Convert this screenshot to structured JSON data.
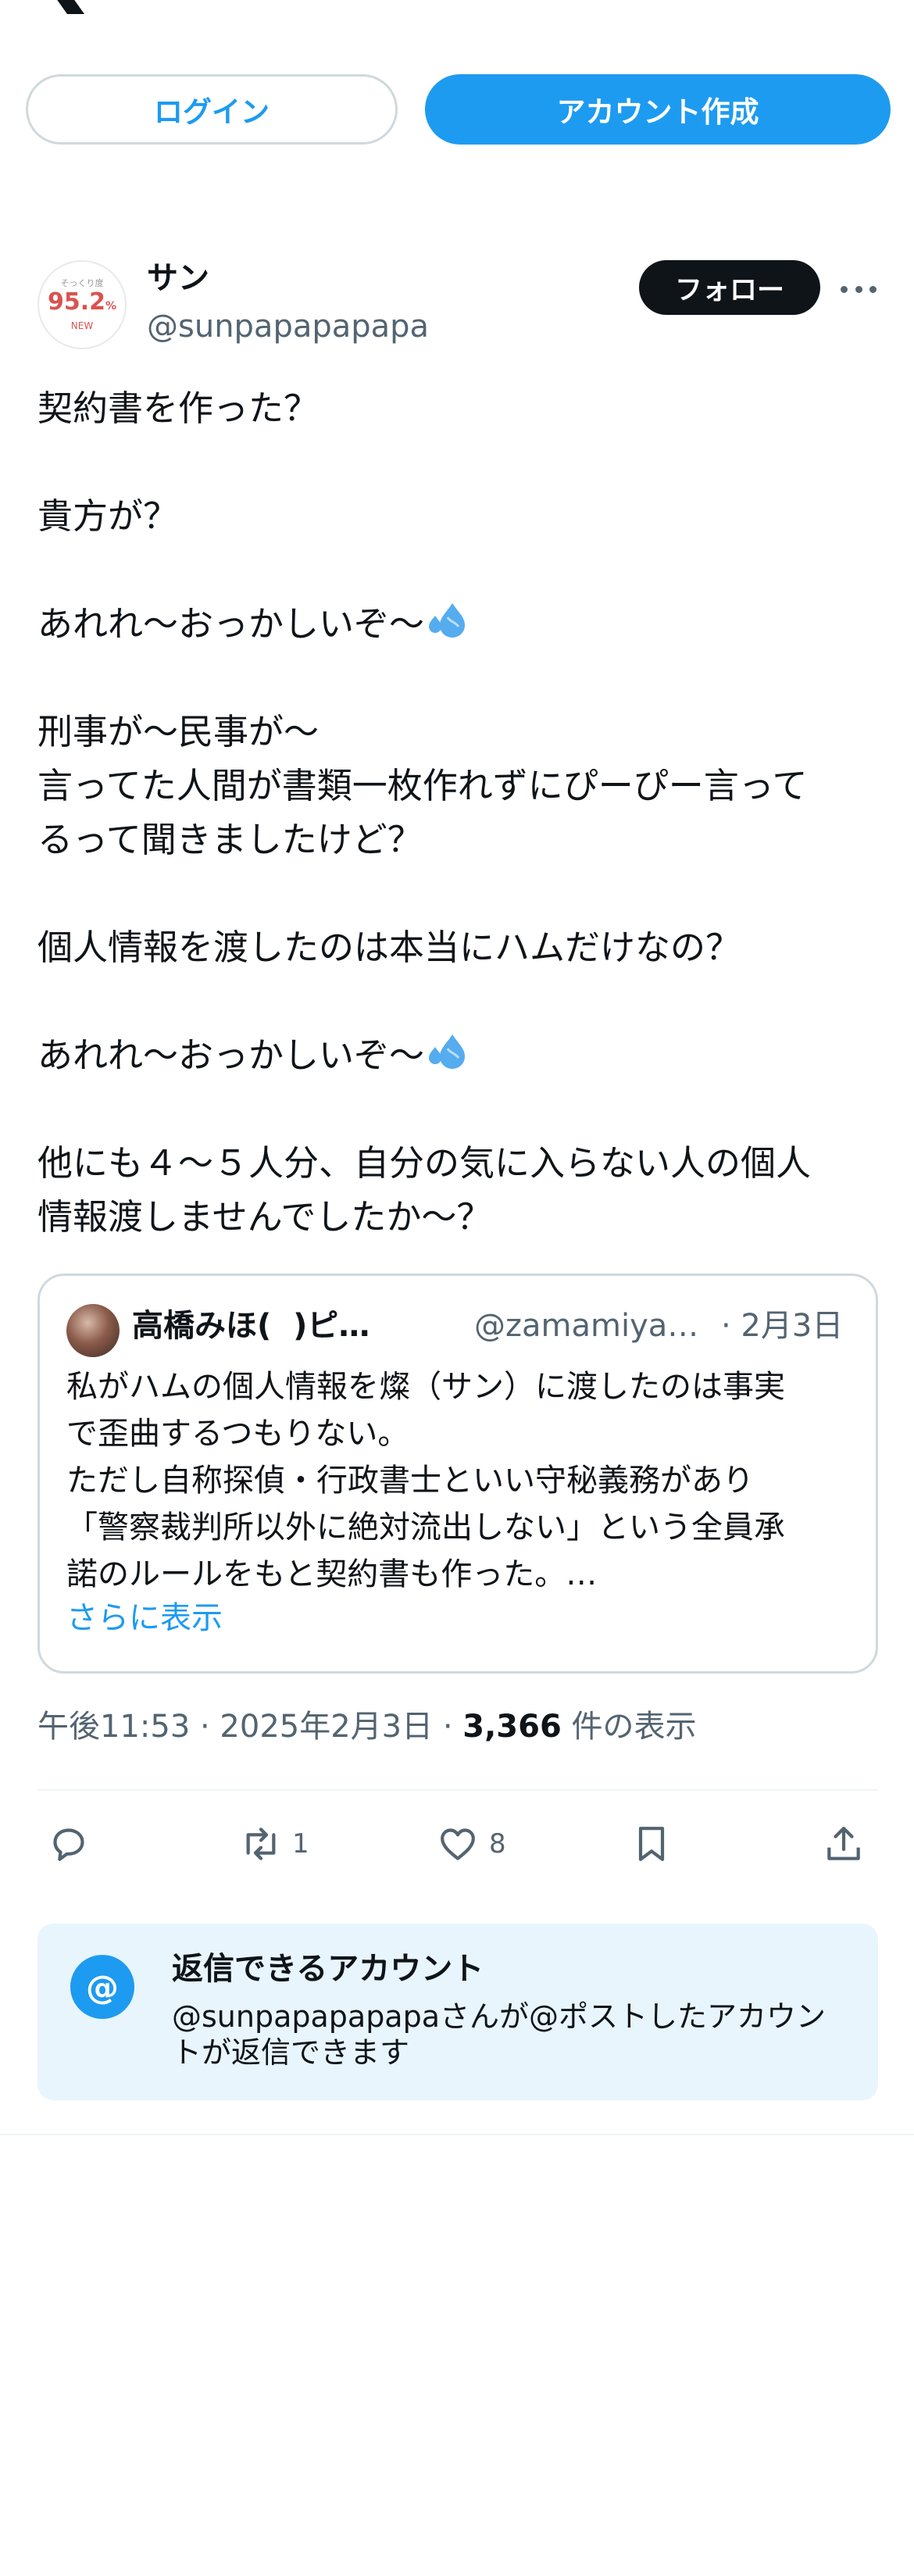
{
  "header": {
    "logo_icon": "x-logo-icon",
    "login_label": "ログイン",
    "signup_label": "アカウント作成"
  },
  "author": {
    "avatar_top_text": "そっくり度",
    "avatar_value": "95.2",
    "avatar_unit": "%",
    "avatar_badge": "NEW",
    "name": "サン",
    "handle": "@sunpapapapapa",
    "follow_label": "フォロー",
    "more_icon": "more-horizontal-icon"
  },
  "tweet": {
    "lines": [
      "契約書を作った？",
      "",
      "貴方が？",
      "",
      "あれれ〜おっかしいぞ〜",
      "",
      "刑事が〜民事が〜",
      "言ってた人間が書類一枚作れずにぴーぴー言って",
      "るって聞きましたけど？",
      "",
      "個人情報を渡したのは本当にハムだけなの？",
      "",
      "あれれ〜おっかしいぞ〜",
      "",
      "他にも４〜５人分、自分の気に入らない人の個人",
      "情報渡しませんでしたか〜？"
    ],
    "emoji_icon": "sweat-droplets-icon"
  },
  "quote": {
    "name": "高橋みほ( ￼￼￼ )ピ…",
    "handle": "@zamamiya…",
    "date": "· 2月3日",
    "lines": [
      "私がハムの個人情報を燦（サン）に渡したのは事実",
      "で歪曲するつもりない。",
      "ただし自称探偵・行政書士といい守秘義務があり",
      "「警察裁判所以外に絶対流出しない」という全員承",
      "諾のルールをもと契約書も作った。…"
    ],
    "show_more": "さらに表示"
  },
  "meta": {
    "time": "午後11:53 · 2025年2月3日 · ",
    "views_count": "3,366",
    "views_label": " 件の表示"
  },
  "actions": {
    "reply_icon": "reply-icon",
    "retweet_icon": "retweet-icon",
    "retweet_count": "1",
    "like_icon": "heart-icon",
    "like_count": "8",
    "bookmark_icon": "bookmark-icon",
    "share_icon": "share-icon"
  },
  "reply_restriction": {
    "icon_glyph": "@",
    "title": "返信できるアカウント",
    "description": "@sunpapapapapaさんが@ポストしたアカウントが返信できます"
  },
  "colors": {
    "accent": "#1d9bf0",
    "text": "#0f1419",
    "secondary": "#536471",
    "border": "#cfd9de",
    "card_bg": "#e8f5fd"
  }
}
